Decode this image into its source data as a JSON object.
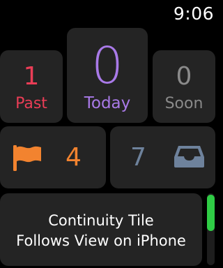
{
  "status_bar": {
    "time": "9:06"
  },
  "tiles": {
    "past": {
      "count": "1",
      "label": "Past",
      "color": "#ea3d56"
    },
    "today": {
      "count": "0",
      "label": "Today",
      "color": "#a97ae8"
    },
    "soon": {
      "count": "0",
      "label": "Soon",
      "color": "#8a8a8a"
    },
    "flagged": {
      "count": "4",
      "icon": "flag-icon",
      "color": "#f2832f"
    },
    "inbox": {
      "count": "7",
      "icon": "inbox-tray-icon",
      "color": "#6e829c"
    }
  },
  "continuity_tile": {
    "line1": "Continuity Tile",
    "line2": "Follows View on iPhone"
  },
  "scroll_indicator": {
    "color": "#2fcc45"
  }
}
